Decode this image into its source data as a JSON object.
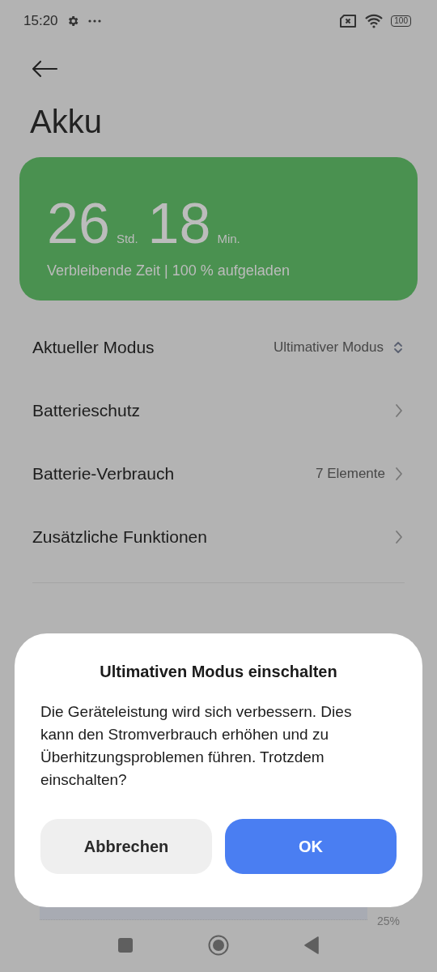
{
  "status_bar": {
    "time": "15:20",
    "battery": "100"
  },
  "page": {
    "title": "Akku"
  },
  "battery_card": {
    "hours": "26",
    "hours_unit": "Std.",
    "minutes": "18",
    "minutes_unit": "Min.",
    "caption": "Verbleibende Zeit | 100 % aufgeladen"
  },
  "settings": [
    {
      "kind": "select",
      "label": "Aktueller Modus",
      "value": "Ultimativer Modus"
    },
    {
      "kind": "link",
      "label": "Batterieschutz"
    },
    {
      "kind": "link",
      "label": "Batterie-Verbrauch",
      "value": "7 Elemente"
    },
    {
      "kind": "link",
      "label": "Zusätzliche Funktionen"
    }
  ],
  "chart_hint": {
    "axis_label": "25%"
  },
  "dialog": {
    "title": "Ultimativen Modus einschalten",
    "message": "Die Geräteleistung wird sich verbessern. Dies kann den Stromverbrauch erhöhen und zu Überhitzungsproblemen führen. Trotzdem einschalten?",
    "buttons": [
      {
        "label": "Abbrechen",
        "kind": "secondary"
      },
      {
        "label": "OK",
        "kind": "primary"
      }
    ]
  }
}
